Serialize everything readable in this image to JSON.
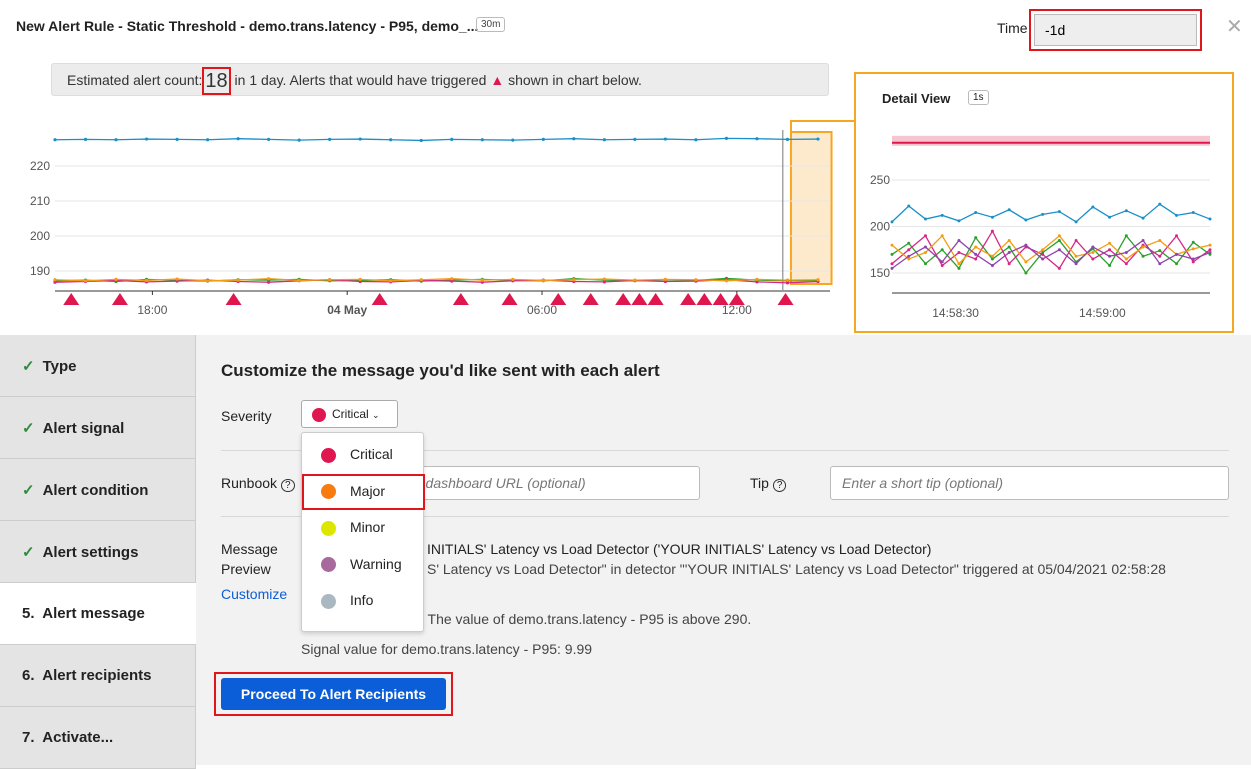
{
  "header": {
    "title": "New Alert Rule - Static Threshold - demo.trans.latency - P95, demo_...",
    "resolution": "30m",
    "time_label": "Time",
    "time_value": "-1d",
    "close_icon": "close-icon"
  },
  "banner": {
    "prefix": "Estimated alert count:",
    "count": "18",
    "suffix1": "in 1 day. Alerts that would have triggered",
    "suffix2": "shown in chart below."
  },
  "colors": {
    "alert": "#e0164f",
    "highlight": "#f5a623",
    "primary": "#0b5ed7",
    "check": "#2e8b3a"
  },
  "chart_data": [
    {
      "type": "line",
      "y_ticks": [
        "190",
        "200",
        "210",
        "220"
      ],
      "x_ticks": [
        "18:00",
        "04 May",
        "06:00",
        "12:00"
      ],
      "ylim": [
        185,
        232
      ],
      "series": [
        {
          "color": "#1a8fc9",
          "values": [
            227.5,
            227.6,
            227.5,
            227.7,
            227.6,
            227.5,
            227.8,
            227.6,
            227.4,
            227.6,
            227.7,
            227.5,
            227.3,
            227.6,
            227.5,
            227.4,
            227.6,
            227.8,
            227.5,
            227.6,
            227.7,
            227.5,
            227.9,
            227.8,
            227.6,
            227.7
          ]
        },
        {
          "color": "#2ca02c",
          "values": [
            187.2,
            187.4,
            187.0,
            187.6,
            187.3,
            187.1,
            187.5,
            187.4,
            187.6,
            187.2,
            187.3,
            187.5,
            187.1,
            187.4,
            187.6,
            187.3,
            187.2,
            187.8,
            187.4,
            187.2,
            187.5,
            187.3,
            187.9,
            187.4,
            187.2,
            187.3
          ]
        },
        {
          "color": "#d62787",
          "values": [
            186.8,
            187.0,
            187.3,
            186.9,
            187.1,
            187.4,
            187.0,
            186.8,
            187.2,
            187.5,
            187.0,
            186.9,
            187.3,
            187.1,
            186.8,
            187.2,
            187.4,
            187.0,
            186.9,
            187.3,
            187.0,
            187.1,
            187.5,
            186.9,
            186.6,
            187.0
          ]
        },
        {
          "color": "#f39c12",
          "values": [
            187.5,
            187.2,
            187.6,
            187.3,
            187.7,
            187.2,
            187.4,
            187.8,
            187.3,
            187.5,
            187.6,
            187.2,
            187.5,
            187.8,
            187.4,
            187.6,
            187.3,
            187.5,
            187.7,
            187.4,
            187.6,
            187.5,
            187.2,
            187.6,
            187.4,
            187.5
          ]
        }
      ],
      "alerts": [
        "03 May 15:30",
        "03 May 17:00",
        "03 May 20:30",
        "04 May 01:00",
        "04 May 03:30",
        "04 May 05:00",
        "04 May 06:30",
        "04 May 07:30",
        "04 May 08:30",
        "04 May 09:00",
        "04 May 09:30",
        "04 May 10:30",
        "04 May 11:00",
        "04 May 11:30",
        "04 May 12:00",
        "04 May 13:30"
      ],
      "x_start": "03 May 15:00",
      "x_end": "04 May 14:30",
      "cursor": "04 May 13:25",
      "highlight_range": [
        "04 May 13:40",
        "04 May 14:55"
      ]
    },
    {
      "type": "line",
      "title": "Detail View",
      "resolution": "1s",
      "y_ticks": [
        "150",
        "200",
        "250"
      ],
      "x_ticks": [
        "14:58:30",
        "14:59:00"
      ],
      "ylim": [
        130,
        300
      ],
      "threshold": 290,
      "x_start": "14:58:17",
      "x_end": "14:59:22",
      "series": [
        {
          "color": "#1a8fc9",
          "values": [
            205,
            222,
            208,
            212,
            206,
            215,
            210,
            218,
            207,
            213,
            216,
            205,
            221,
            210,
            217,
            209,
            224,
            212,
            215,
            208
          ]
        },
        {
          "color": "#2ca02c",
          "values": [
            170,
            182,
            160,
            175,
            155,
            188,
            165,
            178,
            150,
            172,
            185,
            162,
            176,
            158,
            190,
            168,
            174,
            160,
            183,
            170
          ]
        },
        {
          "color": "#d62787",
          "values": [
            160,
            175,
            190,
            158,
            172,
            165,
            195,
            160,
            178,
            170,
            155,
            185,
            165,
            175,
            160,
            180,
            168,
            190,
            162,
            175
          ]
        },
        {
          "color": "#f39c12",
          "values": [
            180,
            165,
            172,
            190,
            160,
            178,
            168,
            185,
            162,
            175,
            190,
            168,
            172,
            182,
            165,
            178,
            185,
            170,
            176,
            180
          ]
        },
        {
          "color": "#8e44ad",
          "values": [
            155,
            168,
            178,
            162,
            185,
            170,
            158,
            172,
            180,
            165,
            175,
            160,
            178,
            168,
            172,
            185,
            160,
            170,
            165,
            172
          ]
        }
      ]
    }
  ],
  "sidebar": [
    {
      "label": "Type",
      "done": true
    },
    {
      "label": "Alert signal",
      "done": true
    },
    {
      "label": "Alert condition",
      "done": true
    },
    {
      "label": "Alert settings",
      "done": true
    },
    {
      "label": "5.  Alert message",
      "done": false,
      "active": true
    },
    {
      "label": "6.  Alert recipients",
      "done": false
    },
    {
      "label": "7.  Activate...",
      "done": false
    }
  ],
  "main": {
    "heading": "Customize the message you'd like sent with each alert",
    "severity_label": "Severity",
    "severity_value": "Critical",
    "severity_options": [
      {
        "label": "Critical",
        "color": "#e0164f"
      },
      {
        "label": "Major",
        "color": "#f77b0f",
        "selected": true
      },
      {
        "label": "Minor",
        "color": "#dde600"
      },
      {
        "label": "Warning",
        "color": "#a86a9c"
      },
      {
        "label": "Info",
        "color": "#aab8c2"
      }
    ],
    "runbook_label": "Runbook",
    "runbook_placeholder": "r dashboard URL (optional)",
    "tip_label": "Tip",
    "tip_placeholder": "Enter a short tip (optional)",
    "message_label": "Message",
    "preview_label": "Preview",
    "customize_link": "Customize",
    "preview_lines": [
      "INITIALS' Latency vs Load Detector ('YOUR INITIALS' Latency vs Load Detector)",
      "S' Latency vs Load Detector\" in detector \"'YOUR INITIALS' Latency vs Load Detector\" triggered at 05/04/2021 02:58:28",
      ": The value of demo.trans.latency - P95 is above 290.",
      "Signal value for demo.trans.latency - P95: 9.99"
    ],
    "proceed_button": "Proceed To Alert Recipients"
  }
}
